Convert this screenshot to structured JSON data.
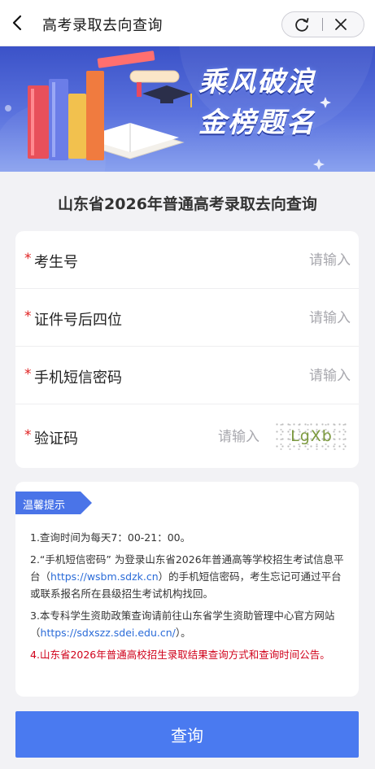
{
  "nav": {
    "title": "高考录取去向查询"
  },
  "banner": {
    "slogan_line1": "乘风破浪",
    "slogan_line2": "金榜题名"
  },
  "heading": "山东省2026年普通高考录取去向查询",
  "form": {
    "fields": [
      {
        "label": "考生号",
        "required_mark": "*",
        "placeholder": "请输入",
        "value": ""
      },
      {
        "label": "证件号后四位",
        "required_mark": "*",
        "placeholder": "请输入",
        "value": ""
      },
      {
        "label": "手机短信密码",
        "required_mark": "*",
        "placeholder": "请输入",
        "value": ""
      },
      {
        "label": "验证码",
        "required_mark": "*",
        "placeholder": "请输入",
        "value": ""
      }
    ],
    "captcha_text": "LgXb"
  },
  "notice": {
    "tag": "温馨提示",
    "item1": "1.查询时间为每天7：00-21：00。",
    "item2_pre": "2.“手机短信密码” 为登录山东省2026年普通高等学校招生考试信息平台（",
    "item2_link": "https://wsbm.sdzk.cn",
    "item2_post": "）的手机短信密码，考生忘记可通过平台或联系报名所在县级招生考试机构找回。",
    "item3_pre": "3.本专科学生资助政策查询请前往山东省学生资助管理中心官方网站（",
    "item3_link": "https://sdxszz.sdei.edu.cn/",
    "item3_post": "）。",
    "item4_pre": "4.",
    "item4_red": "山东省2026年普通高校招生录取结果查询方式和查询时间公告。"
  },
  "submit_label": "查询",
  "colors": {
    "accent": "#4a7af0",
    "required": "#e02020",
    "link": "#2a6bd8",
    "alert": "#d0021b"
  },
  "icons": {
    "back": "chevron-left-icon",
    "refresh": "refresh-icon",
    "close": "close-icon"
  }
}
